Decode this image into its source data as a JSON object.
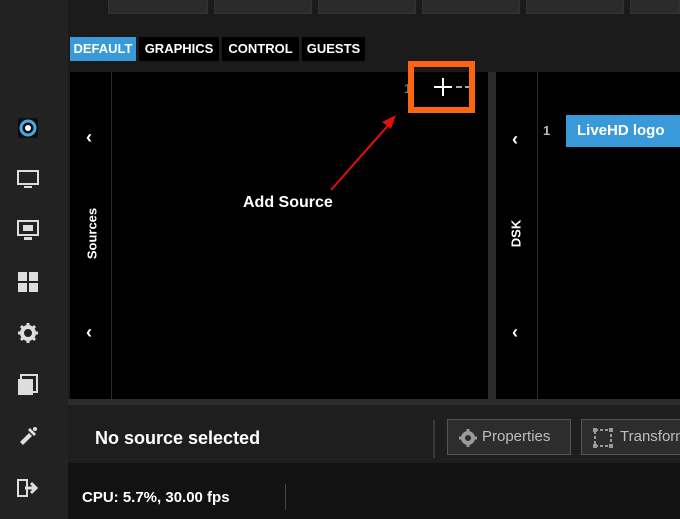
{
  "tabs": [
    {
      "label": "DEFAULT",
      "active": true
    },
    {
      "label": "GRAPHICS",
      "active": false
    },
    {
      "label": "CONTROL",
      "active": false
    },
    {
      "label": "GUESTS",
      "active": false
    }
  ],
  "sources_panel": {
    "label": "Sources"
  },
  "dsk_panel": {
    "label": "DSK",
    "items": [
      {
        "index": "1",
        "label": "LiveHD logo"
      }
    ]
  },
  "annotation": {
    "label": "Add Source",
    "highlight_color": "#ff6411"
  },
  "bottom": {
    "selection_status": "No source selected",
    "properties_label": "Properties",
    "transform_label": "Transform"
  },
  "status": {
    "cpu_text": "CPU: 5.7%, 30.00 fps"
  },
  "colors": {
    "accent": "#3a9ad9",
    "annotation": "#ff6411"
  },
  "sidebar_icons": [
    "app-logo-icon",
    "monitor-icon",
    "screen-share-icon",
    "grid-icon",
    "gear-icon",
    "files-icon",
    "tools-icon",
    "exit-icon"
  ]
}
